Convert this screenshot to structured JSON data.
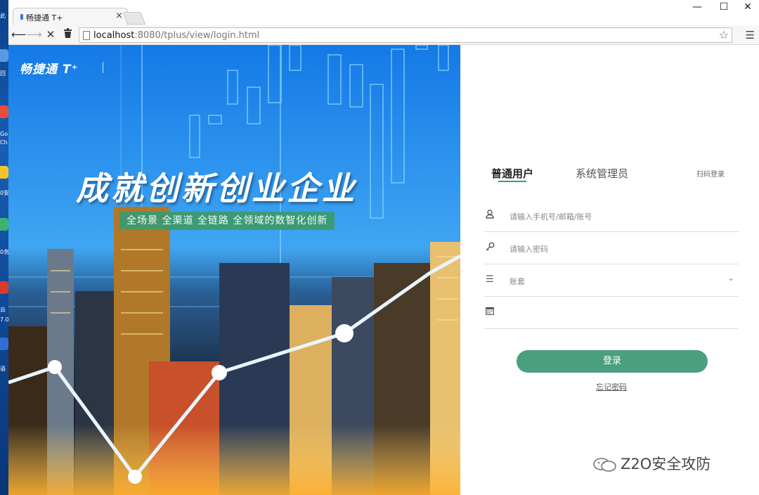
{
  "desktop": {
    "icon_labels": [
      "此",
      "回",
      "Go",
      "Ch",
      "0安",
      "0务",
      "云",
      "7.0",
      "语"
    ]
  },
  "browser": {
    "tab_title": "畅捷通 T+",
    "url_host": "localhost",
    "url_path": ":8080/tplus/view/login.html",
    "window_controls": {
      "minimize": "—",
      "maximize": "☐",
      "close": "✕"
    }
  },
  "hero": {
    "logo_text": "畅捷通 T⁺",
    "headline": "成就创新创业企业",
    "slogan": "全场景 全渠道 全链路 全领域的数智化创新"
  },
  "login": {
    "tabs": [
      {
        "label": "普通用户",
        "active": true
      },
      {
        "label": "系统管理员",
        "active": false
      }
    ],
    "qr_login": "扫码登录",
    "fields": {
      "account_placeholder": "请输入手机号/邮箱/账号",
      "password_placeholder": "请输入密码",
      "book_placeholder": "账套",
      "date_placeholder": ""
    },
    "login_button": "登录",
    "forgot_password": "忘记密码"
  },
  "watermark": {
    "text": "Z2O安全攻防"
  },
  "colors": {
    "accent_green": "#4a9f7e",
    "slogan_green": "#3d9a6f"
  }
}
